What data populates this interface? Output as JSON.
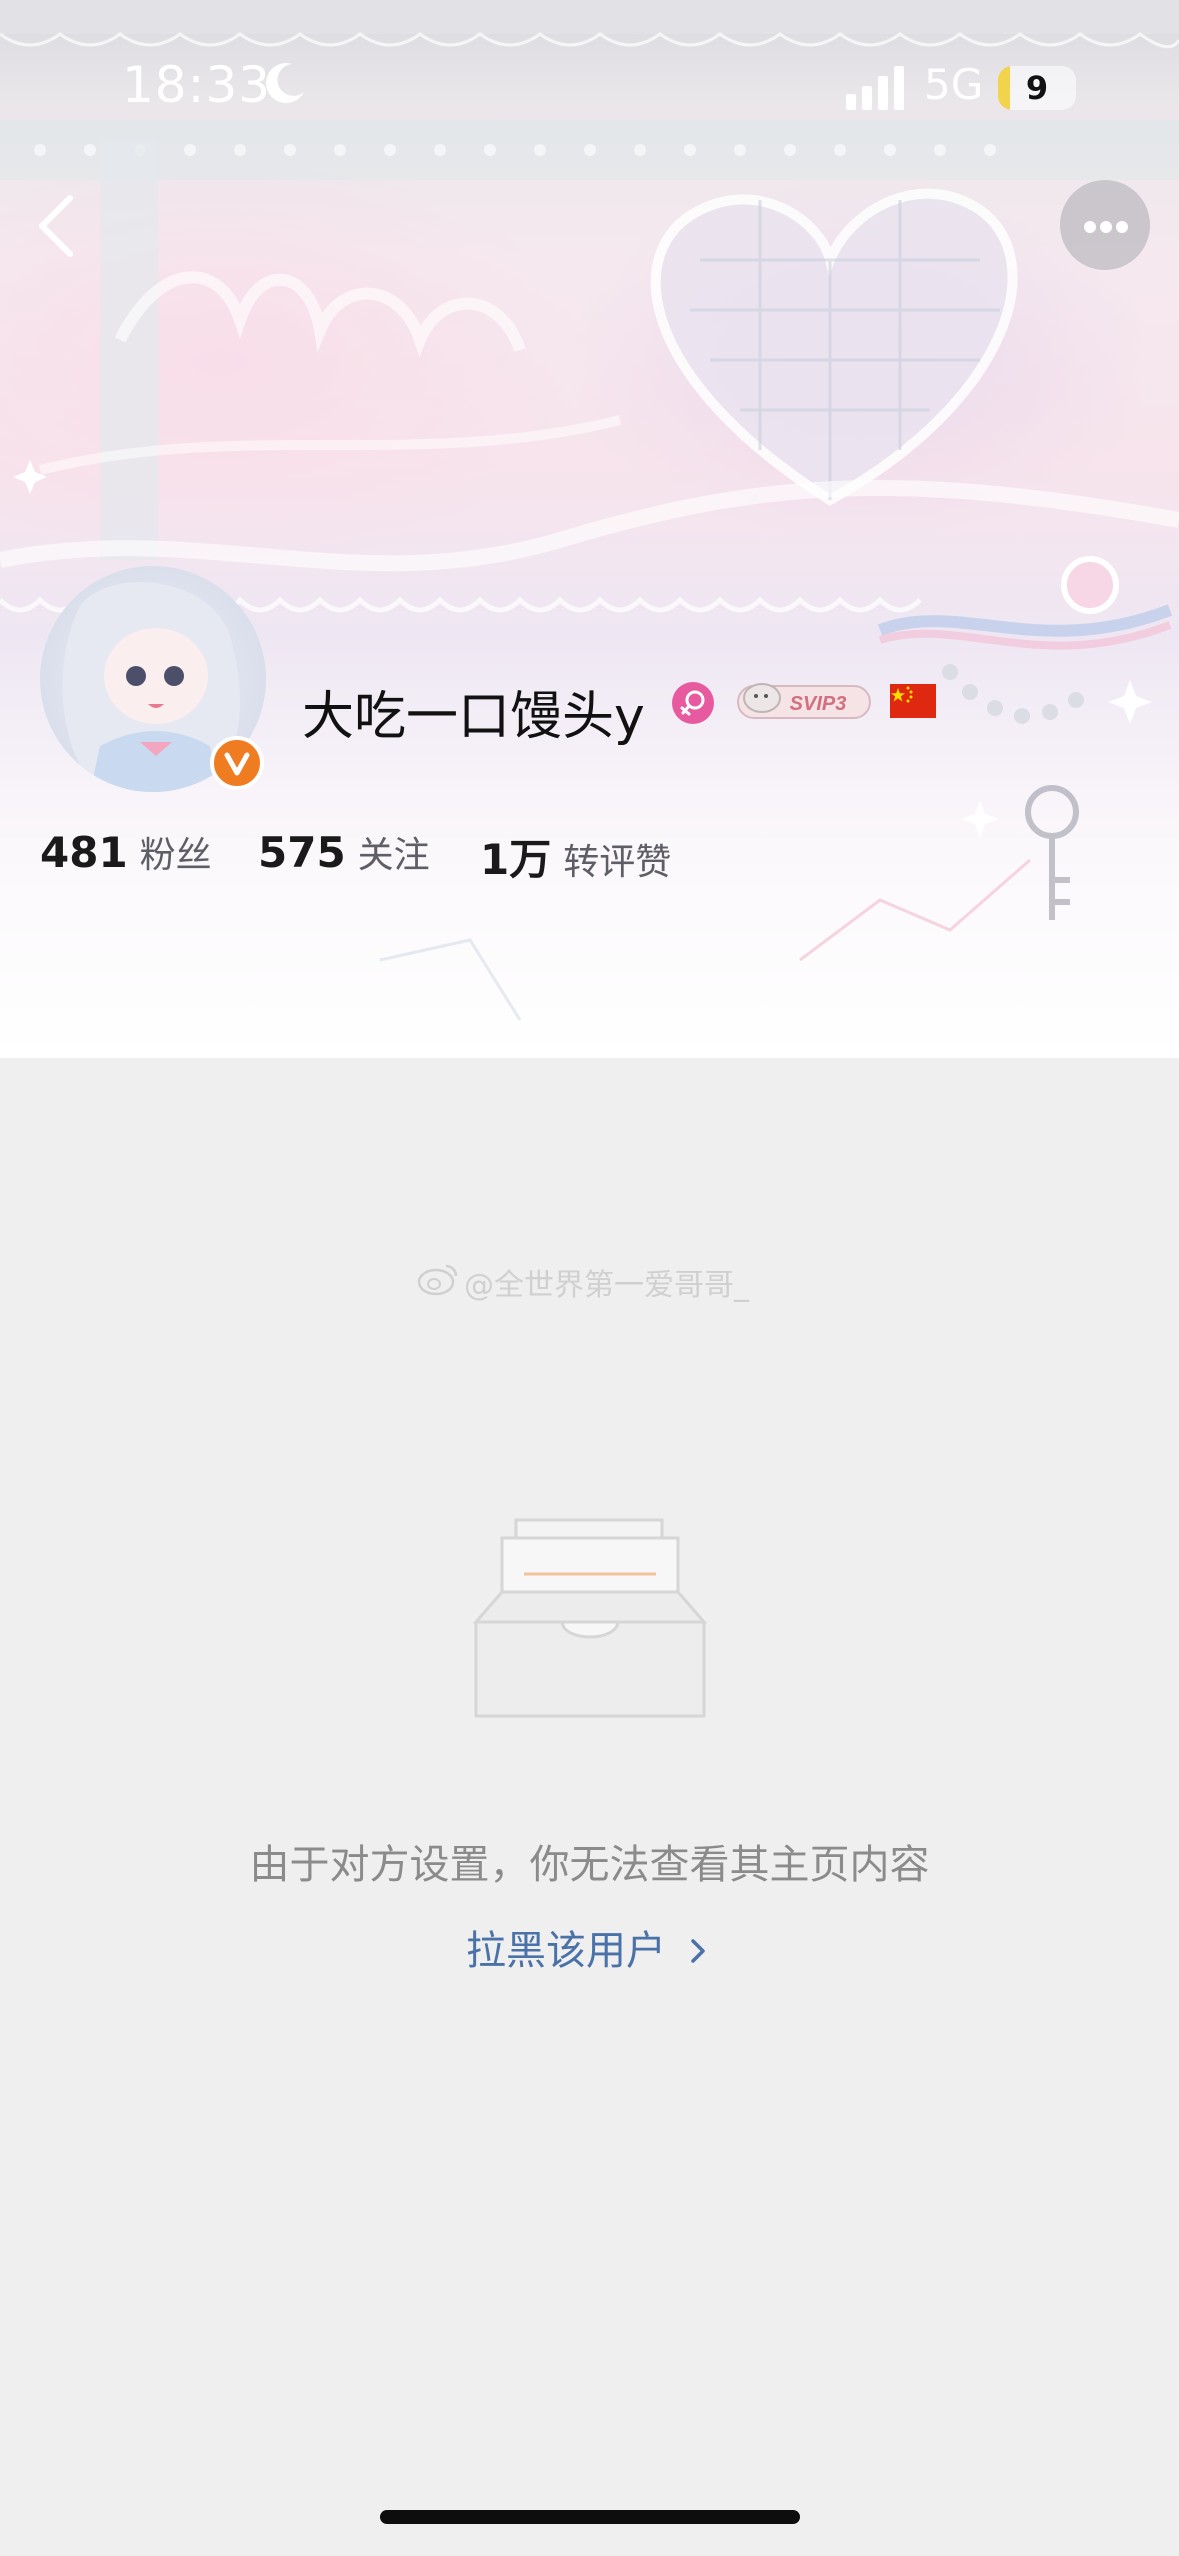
{
  "status_bar": {
    "time": "18:33",
    "network": "5G",
    "battery": "9",
    "icons": [
      "moon-icon",
      "signal-icon"
    ],
    "battery_color": "#f2d34c"
  },
  "nav": {
    "back_icon": "chevron-left-icon",
    "more_icon": "more-dots-icon"
  },
  "profile": {
    "username": "大吃一口馒头y",
    "gender_icon": "female-icon",
    "vip_badge": "SVIP3",
    "flag_icon": "china-flag-icon",
    "verified_color": "#f07c22",
    "stats": [
      {
        "value": "481",
        "label": "粉丝"
      },
      {
        "value": "575",
        "label": "关注"
      },
      {
        "value": "1万",
        "label": "转评赞"
      }
    ]
  },
  "watermark": {
    "text": "@全世界第一爱哥哥_",
    "icon": "weibo-icon"
  },
  "empty_state": {
    "icon": "empty-inbox-icon",
    "message": "由于对方设置，你无法查看其主页内容",
    "link_label": "拉黑该用户",
    "link_icon": "chevron-right-icon",
    "link_color": "#4a72a8"
  }
}
